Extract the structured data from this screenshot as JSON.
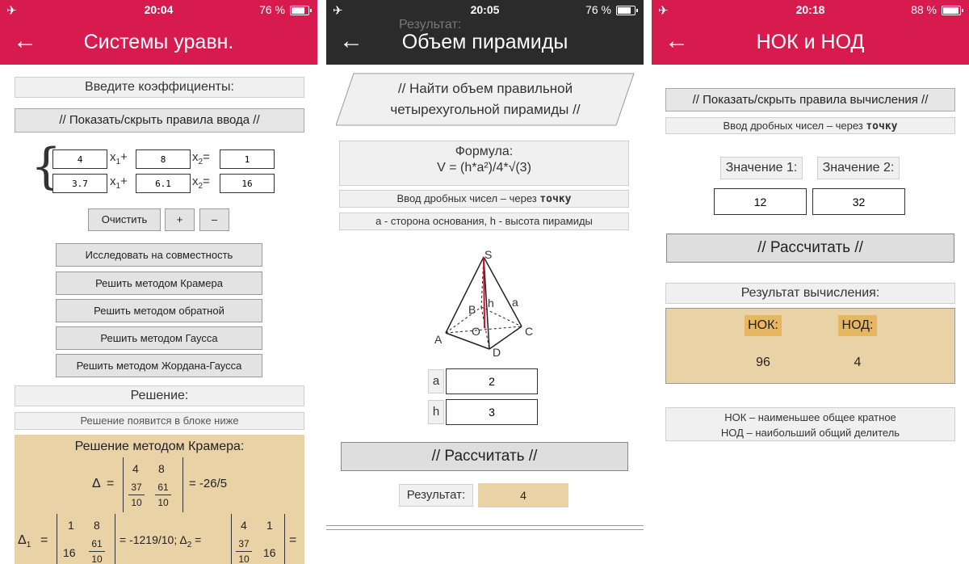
{
  "screen1": {
    "status": {
      "time": "20:04",
      "battery": "76 %"
    },
    "nav": {
      "title": "Системы уравн."
    },
    "enter_coeffs": "Введите коэффициенты:",
    "toggle_rules": "// Показать/скрыть правила ввода //",
    "row1": {
      "a": "4",
      "b": "8",
      "c": "1"
    },
    "row2": {
      "a": "3.7",
      "b": "6.1",
      "c": "16"
    },
    "x1_label": "x",
    "x1_sub": "1",
    "x2_label": "x",
    "x2_sub": "2",
    "plus": "+",
    "equals": "=",
    "btn_clear": "Очистить",
    "btn_plus": "+",
    "btn_minus": "–",
    "actions": [
      "Исследовать на совместность",
      "Решить методом Крамера",
      "Решить методом обратной",
      "Решить методом Гаусса",
      "Решить методом Жордана-Гаусса"
    ],
    "solution_header": "Решение:",
    "solution_hint": "Решение появится в блоке ниже",
    "cramer_title": "Решение методом Крамера:",
    "delta": "Δ",
    "delta1": "Δ",
    "delta1_sub": "1",
    "delta2_sub": "2",
    "m_4": "4",
    "m_8": "8",
    "m_37": "37",
    "m_10": "10",
    "m_61": "61",
    "delta_result": "= -26/5",
    "m_1": "1",
    "m_16": "16",
    "delta1_result": "= -1219/10; Δ",
    "eq_sign": "=",
    "d2_1": "1"
  },
  "screen2": {
    "status": {
      "time": "20:05",
      "battery": "76 %"
    },
    "ghost": "Результат:",
    "nav": {
      "title": "Объем пирамиды"
    },
    "task_line1": "// Найти объем правильной",
    "task_line2": "четырехугольной пирамиды //",
    "formula_label": "Формула:",
    "formula": "V = (h*a²)/4*√(3)",
    "decimal_hint_prefix": "Ввод дробных чисел – через ",
    "decimal_hint_bold": "точку",
    "vars_hint": "a - сторона основания, h - высота пирамиды",
    "points": {
      "S": "S",
      "B": "B",
      "h": "h",
      "a": "a",
      "A": "A",
      "O": "O",
      "C": "C",
      "D": "D"
    },
    "a_label": "a",
    "a_value": "2",
    "h_label": "h",
    "h_value": "3",
    "calculate": "// Рассчитать //",
    "result_label": "Результат:",
    "result_value": "4"
  },
  "screen3": {
    "status": {
      "time": "20:18",
      "battery": "88 %"
    },
    "nav": {
      "title": "НОК и НОД"
    },
    "toggle_rules": "// Показать/скрыть правила вычисления //",
    "decimal_hint_prefix": "Ввод дробных чисел – через ",
    "decimal_hint_bold": "точку",
    "value1_label": "Значение 1:",
    "value2_label": "Значение 2:",
    "value1": "12",
    "value2": "32",
    "calculate": "// Рассчитать //",
    "result_header": "Результат вычисления:",
    "nok_label": "НОК:",
    "nod_label": "НОД:",
    "nok_value": "96",
    "nod_value": "4",
    "legend_line1": "НОК – наименьшее общее кратное",
    "legend_line2": "НОД – наибольший общий делитель"
  },
  "colors": {
    "accent_pink": "#d81b4f",
    "dark_bar": "#2b2b2b",
    "tan": "#e9d3a6"
  },
  "icons": [
    "airplane-icon",
    "back-arrow-icon",
    "battery-icon"
  ]
}
